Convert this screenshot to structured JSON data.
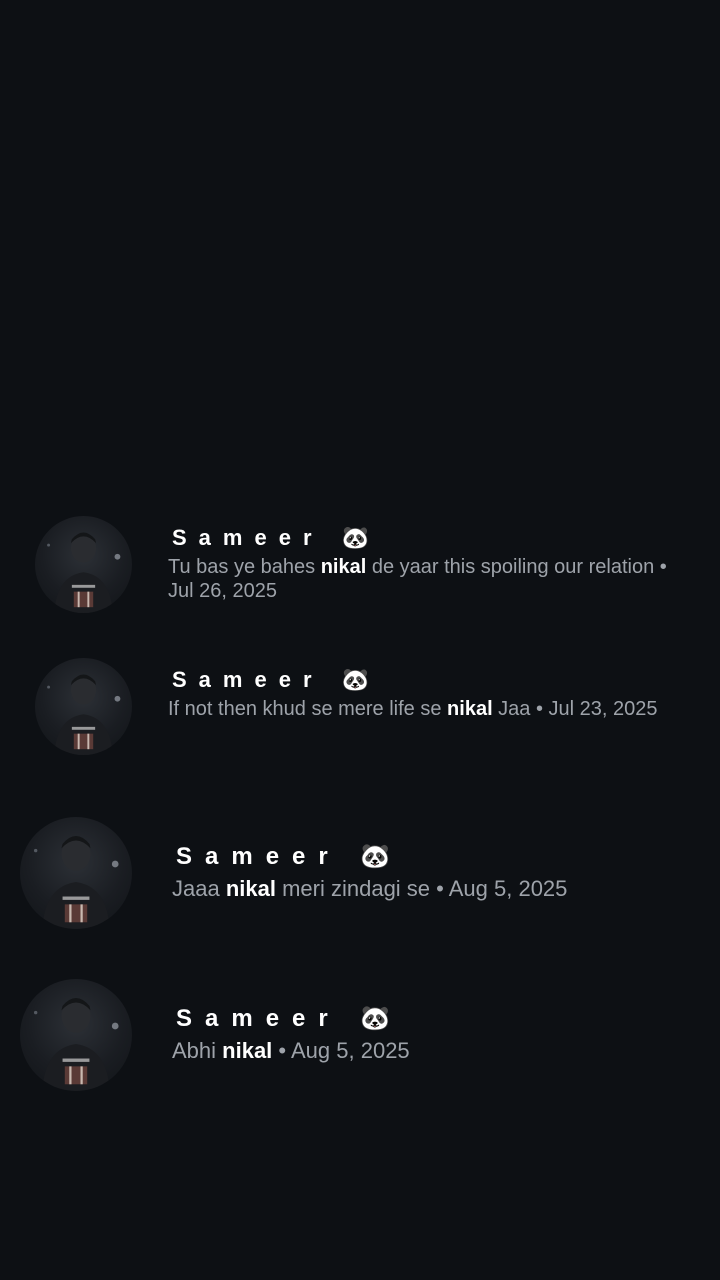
{
  "results": [
    {
      "name": "Sameer",
      "name_emoji": "🐼",
      "before": "Tu bas ye bahes ",
      "highlight": "nikal",
      "after": " de yaar this spoiling our relation • Jul 26, 2025"
    },
    {
      "name": "Sameer",
      "name_emoji": "🐼",
      "before": "If not then khud se mere life se ",
      "highlight": "nikal",
      "after": " Jaa • Jul 23, 2025"
    },
    {
      "name": "Sameer",
      "name_emoji": "🐼",
      "before": "Jaaa ",
      "highlight": "nikal",
      "after": " meri zindagi se • Aug 5, 2025"
    },
    {
      "name": "Sameer",
      "name_emoji": "🐼",
      "before": "Abhi ",
      "highlight": "nikal",
      "after": " • Aug 5, 2025"
    }
  ],
  "avatar_icon": "profile-photo-dark-portrait",
  "colors": {
    "background": "#0d1014",
    "name": "#ffffff",
    "snippet": "#9ea3aa",
    "highlight": "#ffffff"
  }
}
